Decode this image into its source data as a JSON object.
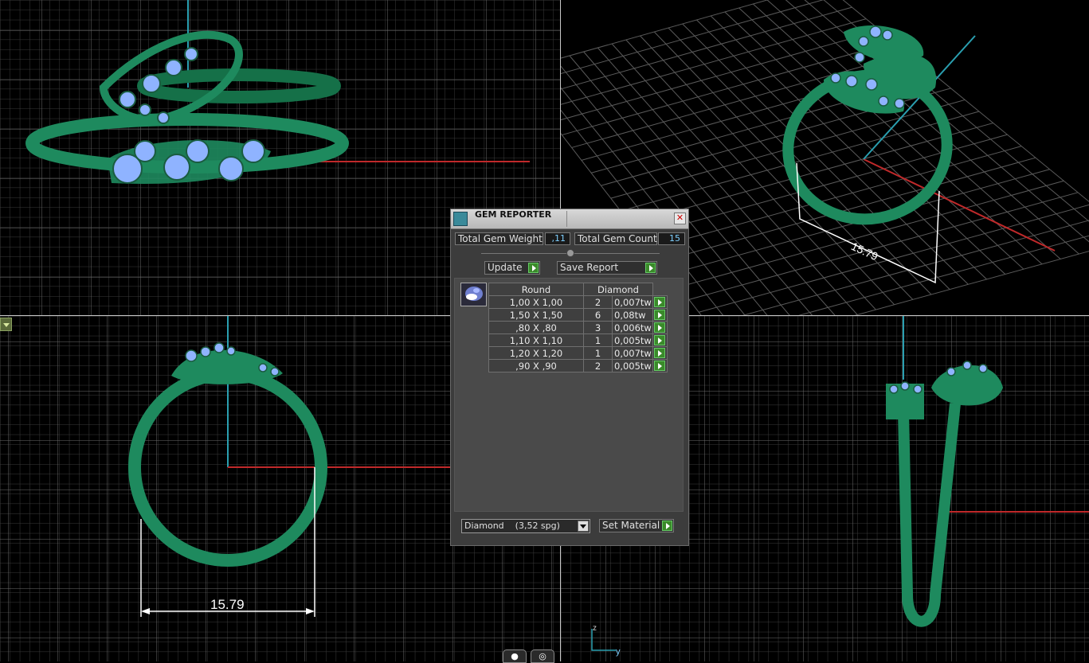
{
  "viewports": {
    "front": {
      "name": "front-view"
    },
    "perspective": {
      "name": "perspective-view",
      "dimension": "15.79"
    },
    "top": {
      "name": "top-view",
      "dimension": "15.79"
    },
    "side": {
      "name": "side-view"
    }
  },
  "axis_triad": {
    "z": "z",
    "y": "y"
  },
  "bottom_tools": [
    "●",
    "◎"
  ],
  "gem_reporter": {
    "title": "GEM REPORTER",
    "close": "✕",
    "total_weight_label": "Total Gem Weight",
    "total_weight_value": ",11",
    "total_count_label": "Total Gem Count",
    "total_count_value": "15",
    "update_label": "Update",
    "save_report_label": "Save Report",
    "table": {
      "shape_header": "Round",
      "material_header": "Diamond",
      "rows": [
        {
          "size": "1,00 X 1,00",
          "qty": "2",
          "weight": "0,007tw"
        },
        {
          "size": "1,50 X 1,50",
          "qty": "6",
          "weight": "0,08tw"
        },
        {
          "size": ",80 X ,80",
          "qty": "3",
          "weight": "0,006tw"
        },
        {
          "size": "1,10 X 1,10",
          "qty": "1",
          "weight": "0,005tw"
        },
        {
          "size": "1,20 X 1,20",
          "qty": "1",
          "weight": "0,007tw"
        },
        {
          "size": ",90 X ,90",
          "qty": "2",
          "weight": "0,005tw"
        }
      ]
    },
    "material_select": "Diamond    (3,52 spg)",
    "set_material_label": "Set Material"
  },
  "colors": {
    "ring": "#1e8a5e",
    "gem": "#8fb3ff",
    "grid": "#3a3a3a",
    "x_axis": "#c0292a",
    "z_axis": "#2a9fb0"
  }
}
